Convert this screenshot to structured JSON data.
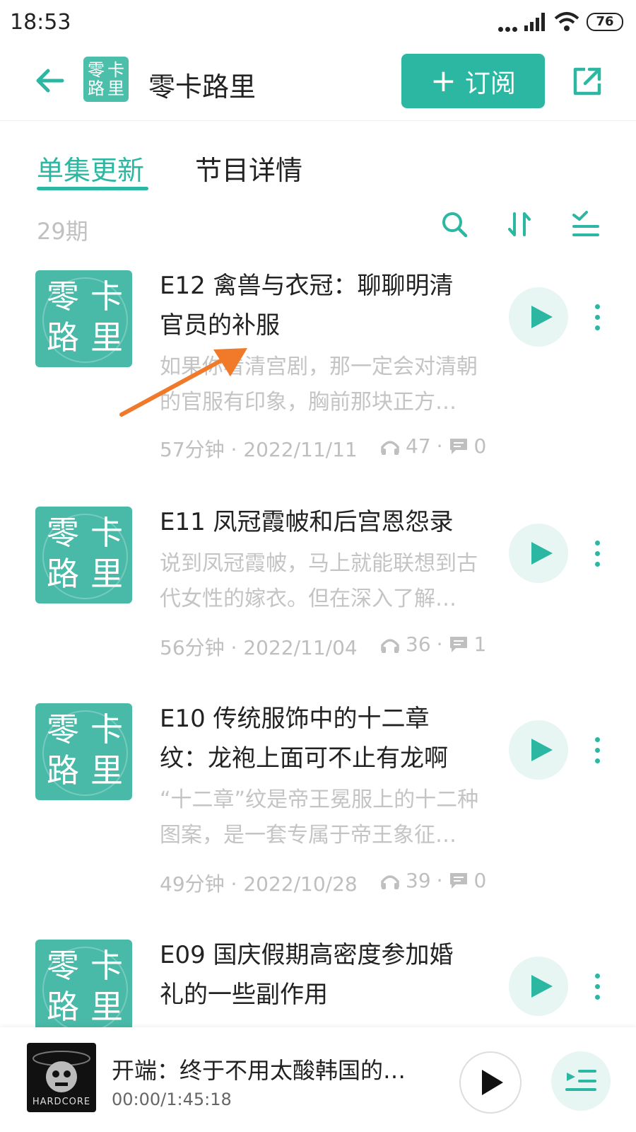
{
  "status_bar": {
    "time": "18:53",
    "battery": "76"
  },
  "header": {
    "title": "零卡路里",
    "logo_chars": [
      "零",
      "卡",
      "路",
      "里"
    ],
    "subscribe_label": "订阅"
  },
  "tabs": [
    {
      "label": "单集更新",
      "active": true
    },
    {
      "label": "节目详情",
      "active": false
    }
  ],
  "list_header": {
    "count": "29期"
  },
  "cover_chars": [
    "零",
    "卡",
    "路",
    "里"
  ],
  "episodes": [
    {
      "title": "E12 禽兽与衣冠：聊聊明清官员的补服",
      "desc": "如果你看清宫剧，那一定会对清朝的官服有印象，胸前那块正方…",
      "meta": "57分钟 · 2022/11/11",
      "listens": "47",
      "comments": "0"
    },
    {
      "title": "E11 凤冠霞帔和后宫恩怨录",
      "desc": "说到凤冠霞帔，马上就能联想到古代女性的嫁衣。但在深入了解…",
      "meta": "56分钟 · 2022/11/04",
      "listens": "36",
      "comments": "1"
    },
    {
      "title": "E10 传统服饰中的十二章纹：龙袍上面可不止有龙啊",
      "desc": "“十二章”纹是帝王冕服上的十二种图案，是一套专属于帝王象征…",
      "meta": "49分钟 · 2022/10/28",
      "listens": "39",
      "comments": "0"
    },
    {
      "title": "E09 国庆假期高密度参加婚礼的一些副作用"
    }
  ],
  "player": {
    "title": "开端：终于不用太酸韩国的鱿…",
    "time": "00:00/1:45:18",
    "art_text": "HARDCORE"
  },
  "colors": {
    "accent": "#2bb7a1",
    "cover": "#49b9a8",
    "arrow": "#f07a2a"
  }
}
